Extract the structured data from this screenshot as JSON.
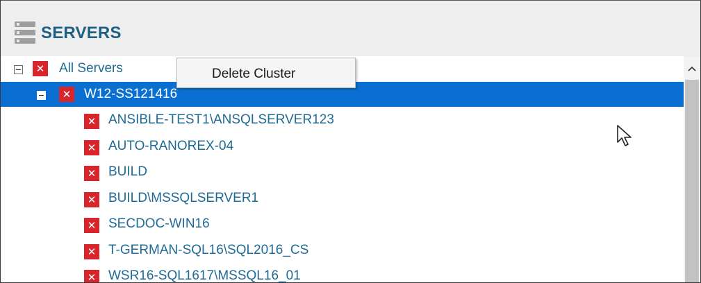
{
  "header": {
    "icon": "server-stack-icon",
    "title": "SERVERS"
  },
  "tree": {
    "root": {
      "label": "All Servers",
      "status_icon": "error-x-icon",
      "expanded": true
    },
    "cluster": {
      "label": "W12-SS121416",
      "status_icon": "error-x-icon",
      "expanded": true,
      "selected": true
    },
    "servers": [
      {
        "label": "ANSIBLE-TEST1\\ANSQLSERVER123",
        "status_icon": "error-x-icon"
      },
      {
        "label": "AUTO-RANOREX-04",
        "status_icon": "error-x-icon"
      },
      {
        "label": "BUILD",
        "status_icon": "error-x-icon"
      },
      {
        "label": "BUILD\\MSSQLSERVER1",
        "status_icon": "error-x-icon"
      },
      {
        "label": "SECDOC-WIN16",
        "status_icon": "error-x-icon"
      },
      {
        "label": "T-GERMAN-SQL16\\SQL2016_CS",
        "status_icon": "error-x-icon"
      },
      {
        "label": "WSR16-SQL1617\\MSSQL16_01",
        "status_icon": "error-x-icon"
      }
    ]
  },
  "context_menu": {
    "items": [
      {
        "label": "Delete Cluster"
      }
    ]
  },
  "scrollbar": {
    "up_arrow": "chevron-up-icon"
  },
  "colors": {
    "accent_title": "#1e5f86",
    "selection": "#0a6fd0",
    "error_icon": "#d9242b",
    "link_text": "#1f6b95"
  },
  "icon_glyph": "✕"
}
